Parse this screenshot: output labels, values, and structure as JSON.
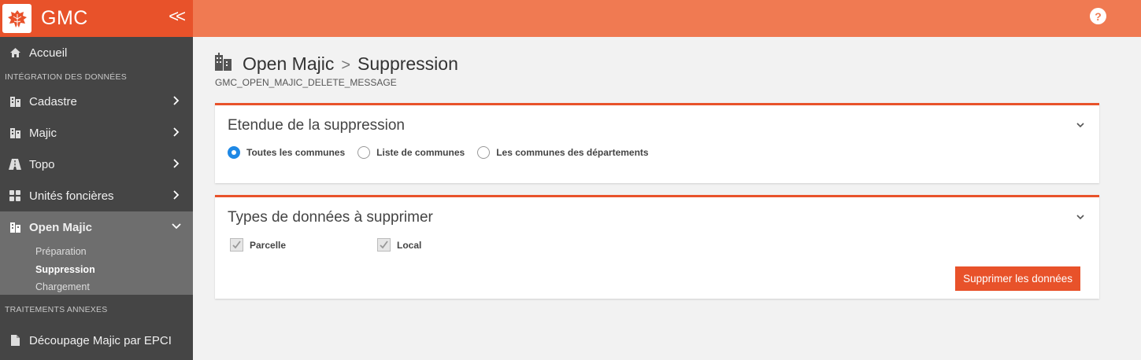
{
  "brand": {
    "name": "GMC",
    "collapse": "<<"
  },
  "sidebar": {
    "home": "Accueil",
    "section_integration": "INTÉGRATION DES DONNÉES",
    "items": [
      {
        "label": "Cadastre",
        "icon": "building-icon"
      },
      {
        "label": "Majic",
        "icon": "building-icon"
      },
      {
        "label": "Topo",
        "icon": "road-icon"
      },
      {
        "label": "Unités foncières",
        "icon": "grid-icon"
      },
      {
        "label": "Open Majic",
        "icon": "building-icon"
      }
    ],
    "sub_items": [
      {
        "label": "Préparation"
      },
      {
        "label": "Suppression"
      },
      {
        "label": "Chargement"
      }
    ],
    "section_annexes": "TRAITEMENTS ANNEXES",
    "decoupage": "Découpage Majic par EPCI"
  },
  "header": {
    "help": "?"
  },
  "page": {
    "crumb_parent": "Open Majic",
    "crumb_sep": ">",
    "crumb_current": "Suppression",
    "subtitle": "GMC_OPEN_MAJIC_DELETE_MESSAGE"
  },
  "scope_card": {
    "title": "Etendue de la suppression",
    "options": [
      "Toutes les communes",
      "Liste de communes",
      "Les communes des départements"
    ],
    "selected": "Toutes les communes"
  },
  "types_card": {
    "title": "Types de données à supprimer",
    "options": [
      "Parcelle",
      "Local"
    ],
    "submit": "Supprimer les données"
  },
  "colors": {
    "accent": "#e8522a",
    "topbar": "#f07a52",
    "sidebar": "#454545",
    "radio": "#1e88e5"
  }
}
